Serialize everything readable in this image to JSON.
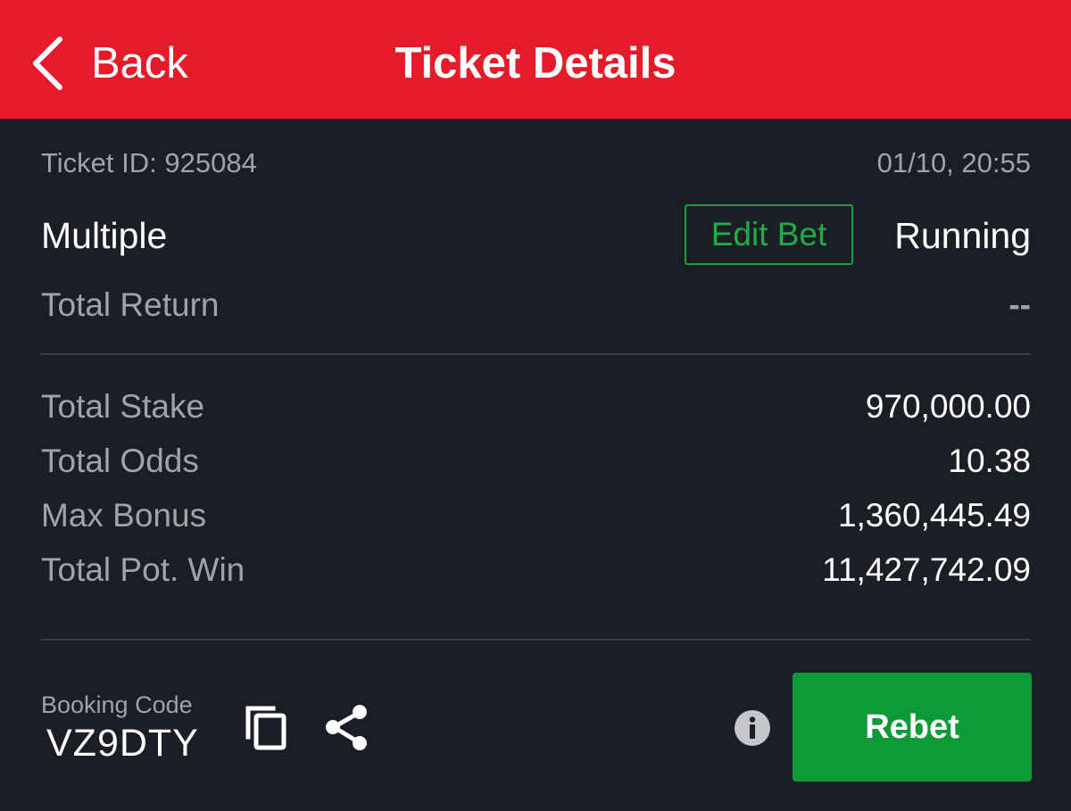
{
  "header": {
    "back_label": "Back",
    "title": "Ticket Details",
    "background_color": "#e41b28"
  },
  "ticket": {
    "id_text": "Ticket ID: 925084",
    "datetime": "01/10, 20:55",
    "bet_type": "Multiple",
    "edit_bet_label": "Edit Bet",
    "status": "Running"
  },
  "summary": {
    "total_return_label": "Total Return",
    "total_return_value": "--",
    "total_stake_label": "Total Stake",
    "total_stake_value": "970,000.00",
    "total_odds_label": "Total Odds",
    "total_odds_value": "10.38",
    "max_bonus_label": "Max Bonus",
    "max_bonus_value": "1,360,445.49",
    "total_pot_win_label": "Total Pot. Win",
    "total_pot_win_value": "11,427,742.09"
  },
  "booking": {
    "label": "Booking Code",
    "code": "VZ9DTY",
    "copy_icon": "copy-icon",
    "share_icon": "share-icon",
    "info_icon": "info-icon"
  },
  "actions": {
    "rebet_label": "Rebet",
    "accent_color": "#0f9a3a"
  }
}
